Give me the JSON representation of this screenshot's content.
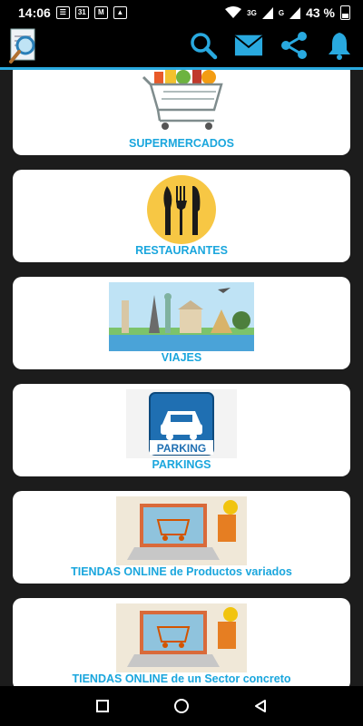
{
  "status_bar": {
    "time": "14:06",
    "calendar_day": "31",
    "network_3g": "3G",
    "network_g": "G",
    "battery": "43 %"
  },
  "app_bar": {
    "accent_color": "#29a9df",
    "icons": [
      "search-icon",
      "mail-icon",
      "share-icon",
      "notifications-icon"
    ]
  },
  "categories": [
    {
      "label": "SUPERMERCADOS",
      "icon": "shopping-cart-image"
    },
    {
      "label": "RESTAURANTES",
      "icon": "cutlery-icon"
    },
    {
      "label": "VIAJES",
      "icon": "travel-landmarks-image"
    },
    {
      "label": "PARKINGS",
      "icon": "parking-sign-icon",
      "sign_text": "PARKING"
    },
    {
      "label": "TIENDAS ONLINE de Productos variados",
      "icon": "online-shopping-image"
    },
    {
      "label": "TIENDAS ONLINE de un Sector concreto",
      "icon": "online-shopping-image"
    }
  ],
  "nav_bar": {
    "icons": [
      "recents-icon",
      "home-icon",
      "back-icon"
    ]
  }
}
